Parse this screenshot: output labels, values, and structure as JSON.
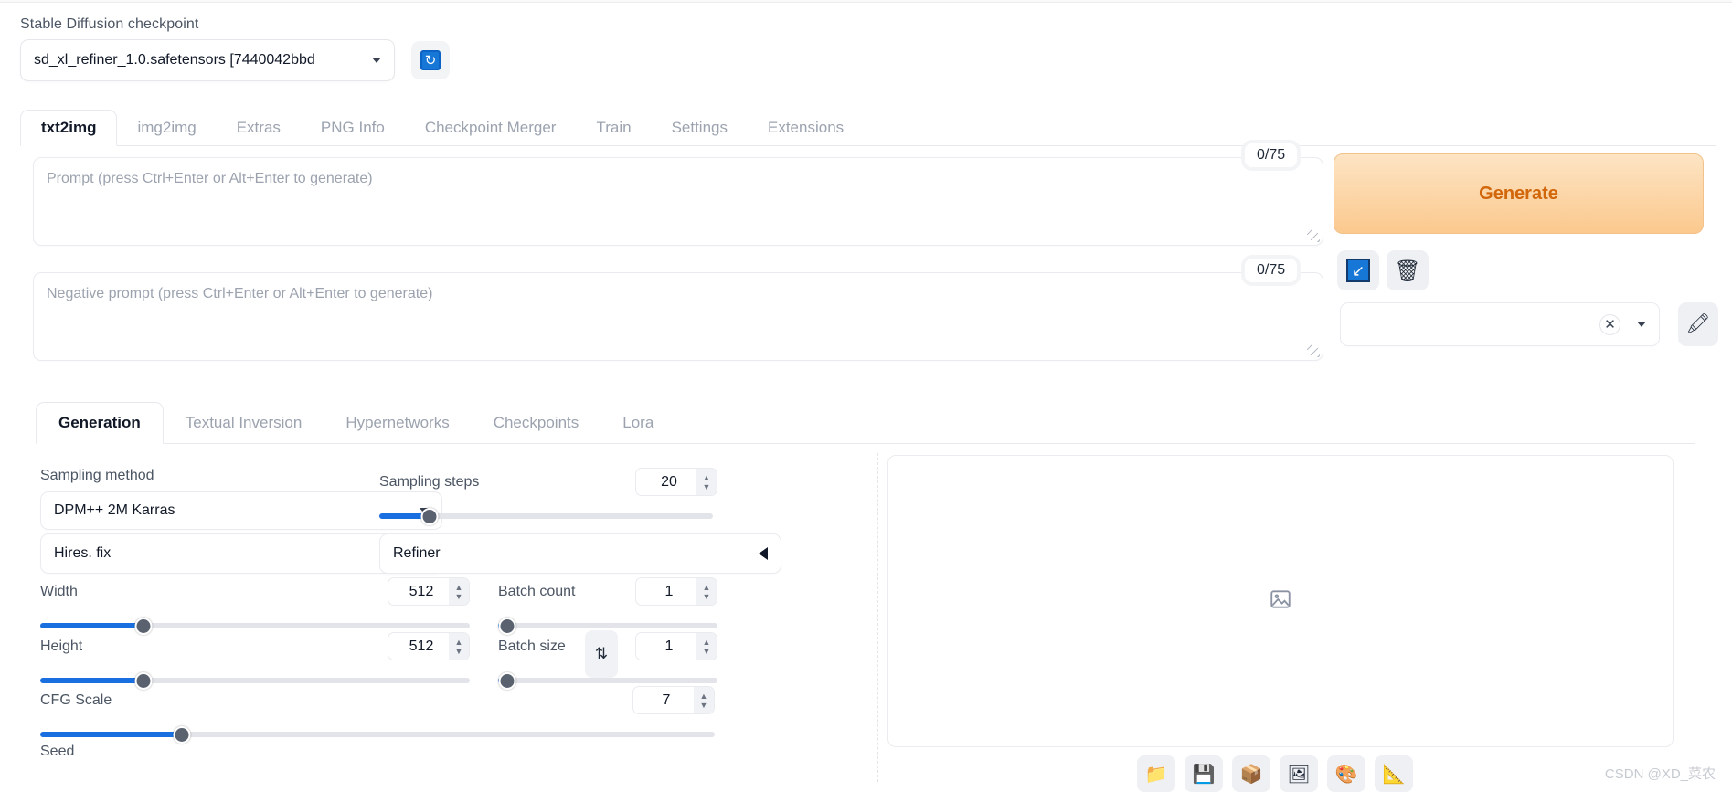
{
  "checkpoint": {
    "label": "Stable Diffusion checkpoint",
    "value": "sd_xl_refiner_1.0.safetensors [7440042bbd",
    "refresh_icon": "refresh-icon",
    "refresh_glyph": "↻"
  },
  "main_tabs": [
    {
      "label": "txt2img",
      "active": true
    },
    {
      "label": "img2img",
      "active": false
    },
    {
      "label": "Extras",
      "active": false
    },
    {
      "label": "PNG Info",
      "active": false
    },
    {
      "label": "Checkpoint Merger",
      "active": false
    },
    {
      "label": "Train",
      "active": false
    },
    {
      "label": "Settings",
      "active": false
    },
    {
      "label": "Extensions",
      "active": false
    }
  ],
  "prompt": {
    "placeholder": "Prompt (press Ctrl+Enter or Alt+Enter to generate)",
    "value": "",
    "token_count": "0/75"
  },
  "negative_prompt": {
    "placeholder": "Negative prompt (press Ctrl+Enter or Alt+Enter to generate)",
    "value": "",
    "token_count": "0/75"
  },
  "actions": {
    "generate_label": "Generate",
    "generate_color": "#d1660a",
    "arrow_button_icon": "arrow-down-left-icon",
    "arrow_glyph": "↙",
    "trash_button_icon": "trash-icon",
    "trash_glyph": "🗑",
    "styles_value": "",
    "styles_clear_glyph": "✕",
    "paint_button_icon": "paintbrush-icon",
    "paint_glyph": "🖍"
  },
  "sub_tabs": [
    {
      "label": "Generation",
      "active": true
    },
    {
      "label": "Textual Inversion",
      "active": false
    },
    {
      "label": "Hypernetworks",
      "active": false
    },
    {
      "label": "Checkpoints",
      "active": false
    },
    {
      "label": "Lora",
      "active": false
    }
  ],
  "settings": {
    "sampling_method": {
      "label": "Sampling method",
      "value": "DPM++ 2M Karras"
    },
    "sampling_steps": {
      "label": "Sampling steps",
      "value": "20",
      "percent": 15
    },
    "hires_fix": {
      "label": "Hires. fix"
    },
    "refiner": {
      "label": "Refiner"
    },
    "width": {
      "label": "Width",
      "value": "512",
      "percent": 24
    },
    "height": {
      "label": "Height",
      "value": "512",
      "percent": 24
    },
    "cfg_scale": {
      "label": "CFG Scale",
      "value": "7",
      "percent": 21
    },
    "batch_count": {
      "label": "Batch count",
      "value": "1",
      "percent": 2
    },
    "batch_size": {
      "label": "Batch size",
      "value": "1",
      "percent": 2
    },
    "seed": {
      "label": "Seed"
    },
    "swap_glyph": "⇅"
  },
  "output": {
    "placeholder_icon": "image-placeholder-icon",
    "tools": [
      {
        "name": "open-folder-button",
        "glyph": "📁"
      },
      {
        "name": "save-button",
        "glyph": "💾"
      },
      {
        "name": "zip-button",
        "glyph": "📦"
      },
      {
        "name": "send-to-img2img-button",
        "glyph": "🖼"
      },
      {
        "name": "send-to-inpaint-button",
        "glyph": "🎨"
      },
      {
        "name": "send-to-extras-button",
        "glyph": "📐"
      }
    ]
  },
  "watermark": "CSDN @XD_菜农"
}
